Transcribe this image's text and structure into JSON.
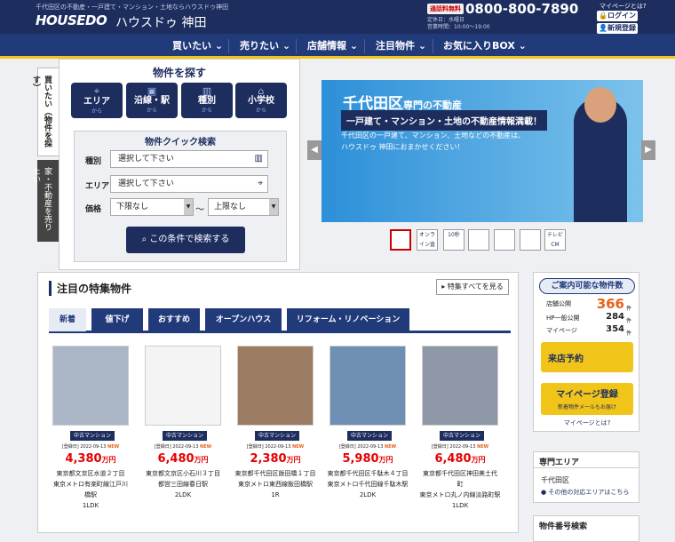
{
  "header": {
    "tagline": "千代田区の不動産・一戸建て・マンション・土地ならハウスドゥ神田",
    "logo": "HOUSEDO",
    "logo_kana": "ハウスドゥ 神田",
    "tel_badge": "通話料無料",
    "tel_number": "0800-800-7890",
    "hours_1": "定休日：水曜日",
    "hours_2": "営業時間：10:00～19:00",
    "mypage_question": "マイページとは?",
    "login": "ログイン",
    "register": "新規登録"
  },
  "nav": [
    "買いたい",
    "売りたい",
    "店舗情報",
    "注目物件",
    "お気に入りBOX"
  ],
  "side_tabs": [
    "買いたい（物件を探す）",
    "家・不動産を売りたい"
  ],
  "search": {
    "title": "物件を探す",
    "buttons": [
      {
        "label": "エリア",
        "sub": "から",
        "icon": "map-pin-icon"
      },
      {
        "label": "沿線・駅",
        "sub": "から",
        "icon": "train-icon"
      },
      {
        "label": "種別",
        "sub": "から",
        "icon": "building-icon"
      },
      {
        "label": "小学校",
        "sub": "から",
        "icon": "school-icon"
      }
    ],
    "quick": {
      "title": "物件クイック検索",
      "type_label": "種別",
      "type_value": "選択して下さい",
      "area_label": "エリア",
      "area_value": "選択して下さい",
      "price_label": "価格",
      "price_min": "下限なし",
      "price_max": "上限なし",
      "tilde": "～",
      "submit": "この条件で検索する"
    }
  },
  "hero": {
    "line1_big": "千代田区",
    "line1_small": "専門の不動産",
    "line2": "一戸建て・マンション・土地の不動産情報満載！",
    "line3": "千代田区の一戸建て、マンション、土地などの不動産は、",
    "line4": "ハウスドゥ 神田におまかせください！"
  },
  "featured": {
    "title": "注目の特集物件",
    "see_all": "特集すべてを見る",
    "tabs": [
      "新着",
      "値下げ",
      "おすすめ",
      "オープンハウス",
      "リフォーム・リノベーション"
    ],
    "cards": [
      {
        "type": "中古マンション",
        "date": "[登録日] 2022-09-13",
        "new": "NEW",
        "price": "4,380",
        "unit": "万円",
        "addr1": "東京都文京区水道２丁目",
        "addr2": "東京メトロ有楽町線江戸川",
        "addr3": "橋駅",
        "layout": "1LDK"
      },
      {
        "type": "中古マンション",
        "date": "[登録日] 2022-09-13",
        "new": "NEW",
        "price": "6,480",
        "unit": "万円",
        "addr1": "東京都文京区小石川３丁目",
        "addr2": "都営三田線春日駅",
        "addr3": "",
        "layout": "2LDK"
      },
      {
        "type": "中古マンション",
        "date": "[登録日] 2022-09-13",
        "new": "NEW",
        "price": "2,380",
        "unit": "万円",
        "addr1": "東京都千代田区飯田橋１丁目",
        "addr2": "東京メトロ東西線飯田橋駅",
        "addr3": "",
        "layout": "1R"
      },
      {
        "type": "中古マンション",
        "date": "[登録日] 2022-09-13",
        "new": "NEW",
        "price": "5,980",
        "unit": "万円",
        "addr1": "東京都千代田区千駄木４丁目",
        "addr2": "東京メトロ千代田線千駄木駅",
        "addr3": "",
        "layout": "2LDK"
      },
      {
        "type": "中古マンション",
        "date": "[登録日] 2022-09-13",
        "new": "NEW",
        "price": "6,480",
        "unit": "万円",
        "addr1": "東京都千代田区神田美土代",
        "addr2": "町",
        "addr3": "東京メトロ丸ノ内線淡路町駅",
        "layout": "1LDK"
      }
    ]
  },
  "stats": {
    "title": "ご案内可能な物件数",
    "rows": [
      {
        "label": "店舗公開",
        "num": "366",
        "unit": "件"
      },
      {
        "label": "HP一般公開",
        "num": "284",
        "unit": "件"
      },
      {
        "label": "マイページ",
        "num": "354",
        "unit": "件"
      }
    ],
    "visit": "来店予約",
    "mypage_reg": "マイページ登録",
    "mypage_sub": "新着物件メールもお届け",
    "mypage_what": "マイページとは?"
  },
  "area_box": {
    "title": "専門エリア",
    "area": "千代田区",
    "other": "その他の対応エリアはこちら"
  },
  "number_box": {
    "title": "物件番号検索"
  },
  "thumbs": [
    "",
    "オンライン査定",
    "10秒",
    "",
    "",
    "",
    "テレビCM"
  ],
  "colors": {
    "navy": "#1c2d5e",
    "accent": "#f0c419",
    "price": "#e60000"
  }
}
